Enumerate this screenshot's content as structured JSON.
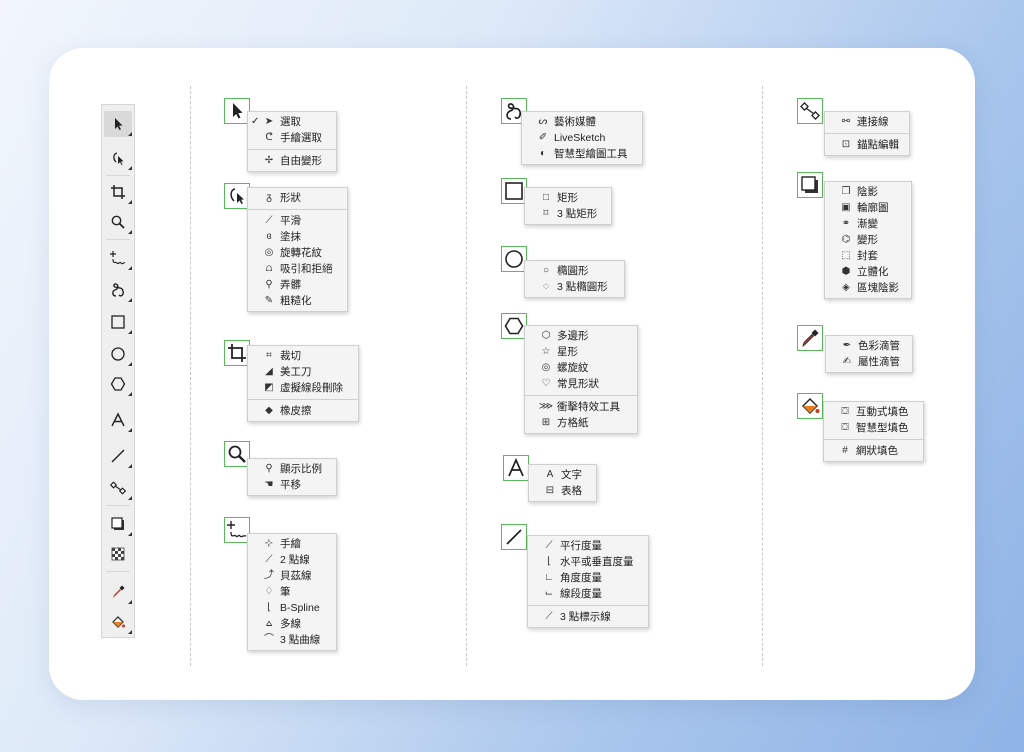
{
  "toolbox": {
    "tools": [
      {
        "name": "pick-tool",
        "icon": "arrow-icon"
      },
      {
        "name": "shape-tool",
        "icon": "shape-edit-icon"
      },
      {
        "name": "crop-tool",
        "icon": "crop-icon"
      },
      {
        "name": "zoom-tool",
        "icon": "magnifier-icon"
      },
      {
        "name": "freehand-tool",
        "icon": "freehand-icon"
      },
      {
        "name": "artistic-media-tool",
        "icon": "artistic-media-icon"
      },
      {
        "name": "rectangle-tool",
        "icon": "rectangle-icon"
      },
      {
        "name": "ellipse-tool",
        "icon": "ellipse-icon"
      },
      {
        "name": "polygon-tool",
        "icon": "polygon-icon"
      },
      {
        "name": "text-tool",
        "icon": "text-icon"
      },
      {
        "name": "dimension-tool",
        "icon": "line-icon"
      },
      {
        "name": "connector-tool",
        "icon": "connector-icon"
      },
      {
        "name": "drop-shadow-tool",
        "icon": "drop-shadow-icon"
      },
      {
        "name": "transparency-tool",
        "icon": "checker-icon"
      },
      {
        "name": "eyedropper-tool",
        "icon": "eyedropper-icon"
      },
      {
        "name": "fill-tool",
        "icon": "fill-bucket-icon"
      }
    ]
  },
  "col1": {
    "pick": {
      "items": [
        "選取",
        "手繪選取"
      ],
      "extra": [
        "自由變形"
      ]
    },
    "shape": {
      "items": [
        "形狀"
      ],
      "extra": [
        "平滑",
        "塗抹",
        "旋轉花紋",
        "吸引和拒絕",
        "弄髒",
        "粗糙化"
      ]
    },
    "crop": {
      "items": [
        "裁切",
        "美工刀",
        "虛擬線段刪除"
      ],
      "extra": [
        "橡皮擦"
      ]
    },
    "zoom": {
      "items": [
        "顯示比例",
        "平移"
      ]
    },
    "curve": {
      "items": [
        "手繪",
        "2 點線",
        "貝茲線",
        "筆",
        "B-Spline",
        "多線",
        "3 點曲線"
      ]
    }
  },
  "col2": {
    "artistic": {
      "items": [
        "藝術媒體",
        "LiveSketch",
        "智慧型繪圖工具"
      ]
    },
    "rect": {
      "items": [
        "矩形",
        "3 點矩形"
      ]
    },
    "ellipse": {
      "items": [
        "橢圓形",
        "3 點橢圓形"
      ]
    },
    "polygon": {
      "items": [
        "多邊形",
        "星形",
        "螺旋紋",
        "常見形狀"
      ],
      "extra": [
        "衝擊特效工具",
        "方格紙"
      ]
    },
    "text": {
      "items": [
        "文字",
        "表格"
      ]
    },
    "dimension": {
      "items": [
        "平行度量",
        "水平或垂直度量",
        "角度度量",
        "線段度量"
      ],
      "extra": [
        "3 點標示線"
      ]
    }
  },
  "col3": {
    "connector": {
      "items": [
        "連接線"
      ],
      "extra": [
        "錨點編輯"
      ]
    },
    "shadow": {
      "items": [
        "陰影",
        "輪廓圖",
        "漸變",
        "變形",
        "封套",
        "立體化",
        "區塊陰影"
      ]
    },
    "eyedropper": {
      "items": [
        "色彩滴管",
        "屬性滴管"
      ]
    },
    "fill": {
      "items": [
        "互動式填色",
        "智慧型填色"
      ],
      "extra": [
        "網狀填色"
      ]
    }
  },
  "colors": {
    "highlight": "#5cb85c",
    "menu_bg": "#f4f4f4"
  }
}
